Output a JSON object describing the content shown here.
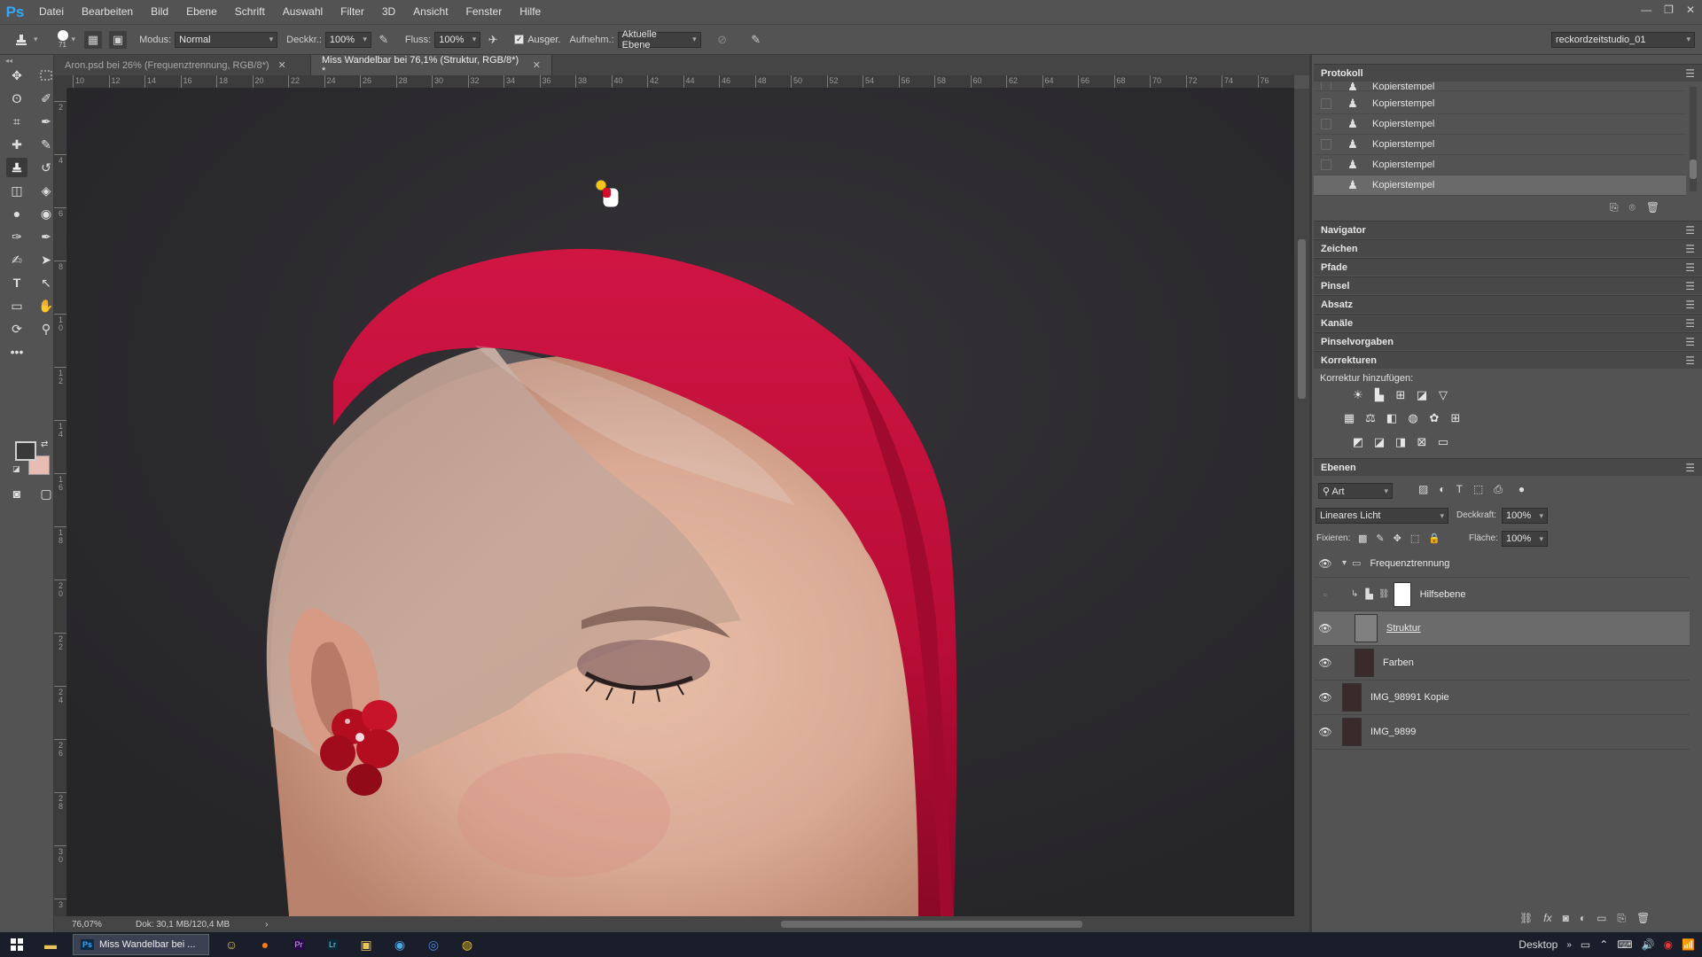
{
  "app": {
    "logo": "Ps"
  },
  "menu": [
    "Datei",
    "Bearbeiten",
    "Bild",
    "Ebene",
    "Schrift",
    "Auswahl",
    "Filter",
    "3D",
    "Ansicht",
    "Fenster",
    "Hilfe"
  ],
  "window_controls": [
    "—",
    "❐",
    "✕"
  ],
  "options": {
    "brush_size": "71",
    "modus_label": "Modus:",
    "modus_value": "Normal",
    "deckkraft_label": "Deckkr.:",
    "deckkraft_value": "100%",
    "fluss_label": "Fluss:",
    "fluss_value": "100%",
    "ausger_label": "Ausger.",
    "aufnehm_label": "Aufnehm.:",
    "aufnehm_value": "Aktuelle Ebene",
    "workspace": "reckordzeitstudio_01"
  },
  "tabs": [
    {
      "label": "Aron.psd bei 26% (Frequenztrennung, RGB/8*)",
      "close": "✕"
    },
    {
      "label": "Miss Wandelbar bei 76,1% (Struktur, RGB/8*) *",
      "close": "✕"
    }
  ],
  "ruler_h": [
    "10",
    "12",
    "14",
    "16",
    "18",
    "20",
    "22",
    "24",
    "26",
    "28",
    "30",
    "32",
    "34",
    "36",
    "38",
    "40",
    "42",
    "44",
    "46",
    "48",
    "50",
    "52",
    "54",
    "56",
    "58",
    "60",
    "62",
    "64",
    "66",
    "68",
    "70",
    "72",
    "74",
    "76"
  ],
  "ruler_v": [
    "2",
    "4",
    "6",
    "8",
    "1\n0",
    "1\n2",
    "1\n4",
    "1\n6",
    "1\n8",
    "2\n0",
    "2\n2",
    "2\n4",
    "2\n6",
    "2\n8",
    "3\n0",
    "3"
  ],
  "status": {
    "zoom": "76,07%",
    "doc": "Dok: 30,1 MB/120,4 MB",
    "arrow": "›"
  },
  "history": {
    "title": "Protokoll",
    "items": [
      "Kopierstempel",
      "Kopierstempel",
      "Kopierstempel",
      "Kopierstempel",
      "Kopierstempel",
      "Kopierstempel"
    ]
  },
  "panels": {
    "navigator": "Navigator",
    "zeichen": "Zeichen",
    "pfade": "Pfade",
    "pinsel": "Pinsel",
    "absatz": "Absatz",
    "kanaele": "Kanäle",
    "pinselvorgaben": "Pinselvorgaben",
    "korrekturen": "Korrekturen",
    "korrektur_hinzufuegen": "Korrektur hinzufügen:",
    "ebenen": "Ebenen"
  },
  "layers": {
    "filter_value": "Art",
    "blend_mode": "Lineares Licht",
    "opacity_label": "Deckkraft:",
    "opacity_value": "100%",
    "lock_label": "Fixieren:",
    "fill_label": "Fläche:",
    "fill_value": "100%",
    "items": [
      {
        "name": "Frequenztrennung",
        "visible": true
      },
      {
        "name": "Hilfsebene",
        "visible": false
      },
      {
        "name": "Struktur",
        "visible": true,
        "selected": true
      },
      {
        "name": "Farben",
        "visible": true
      },
      {
        "name": "IMG_98991 Kopie",
        "visible": true
      },
      {
        "name": "IMG_9899",
        "visible": true
      }
    ]
  },
  "taskbar": {
    "ps_button": "Miss Wandelbar bei ...",
    "desktop_label": "Desktop"
  },
  "colors": {
    "background": "#535353",
    "canvas_bg": "#2b2a2c",
    "hair": "#c8103a",
    "skin": "#d9a994",
    "accent": "#31a8ff",
    "bg_swatch": "#e8bcb2",
    "fg_swatch": "#3a3a3a"
  }
}
